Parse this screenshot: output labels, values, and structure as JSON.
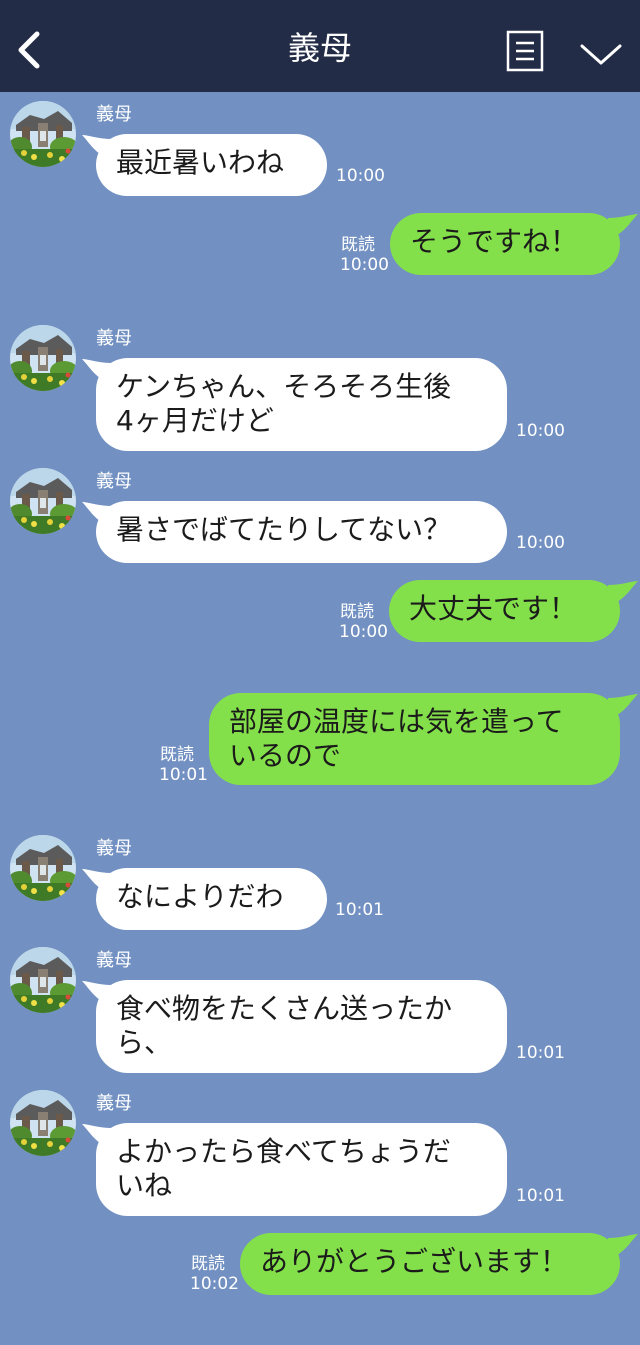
{
  "header": {
    "title": "義母",
    "back_icon": "chevron-left-icon",
    "notes_icon": "notes-icon",
    "menu_icon": "chevron-down-icon",
    "bg": "#232c46"
  },
  "chat_bg": "#7291c2",
  "messages": [
    {
      "dir": "in",
      "sender": "義母",
      "text": "最近暑いわね",
      "time": "10:00"
    },
    {
      "dir": "out",
      "text": "そうですね！",
      "read": "既読",
      "time": "10:00"
    },
    {
      "dir": "in",
      "sender": "義母",
      "text": "ケンちゃん、そろそろ生後\n4ヶ月だけど",
      "time": "10:00"
    },
    {
      "dir": "in",
      "sender": "義母",
      "text": "暑さでばてたりしてない？",
      "time": "10:00"
    },
    {
      "dir": "out",
      "text": "大丈夫です！",
      "read": "既読",
      "time": "10:00"
    },
    {
      "dir": "out",
      "text": "部屋の温度には気を遣って\nいるので",
      "read": "既読",
      "time": "10:01"
    },
    {
      "dir": "in",
      "sender": "義母",
      "text": "なによりだわ",
      "time": "10:01"
    },
    {
      "dir": "in",
      "sender": "義母",
      "text": "食べ物をたくさん送ったか\nら、",
      "time": "10:01"
    },
    {
      "dir": "in",
      "sender": "義母",
      "text": "よかったら食べてちょうだ\nいね",
      "time": "10:01"
    },
    {
      "dir": "out",
      "text": "ありがとうございます！",
      "read": "既読",
      "time": "10:02"
    }
  ]
}
